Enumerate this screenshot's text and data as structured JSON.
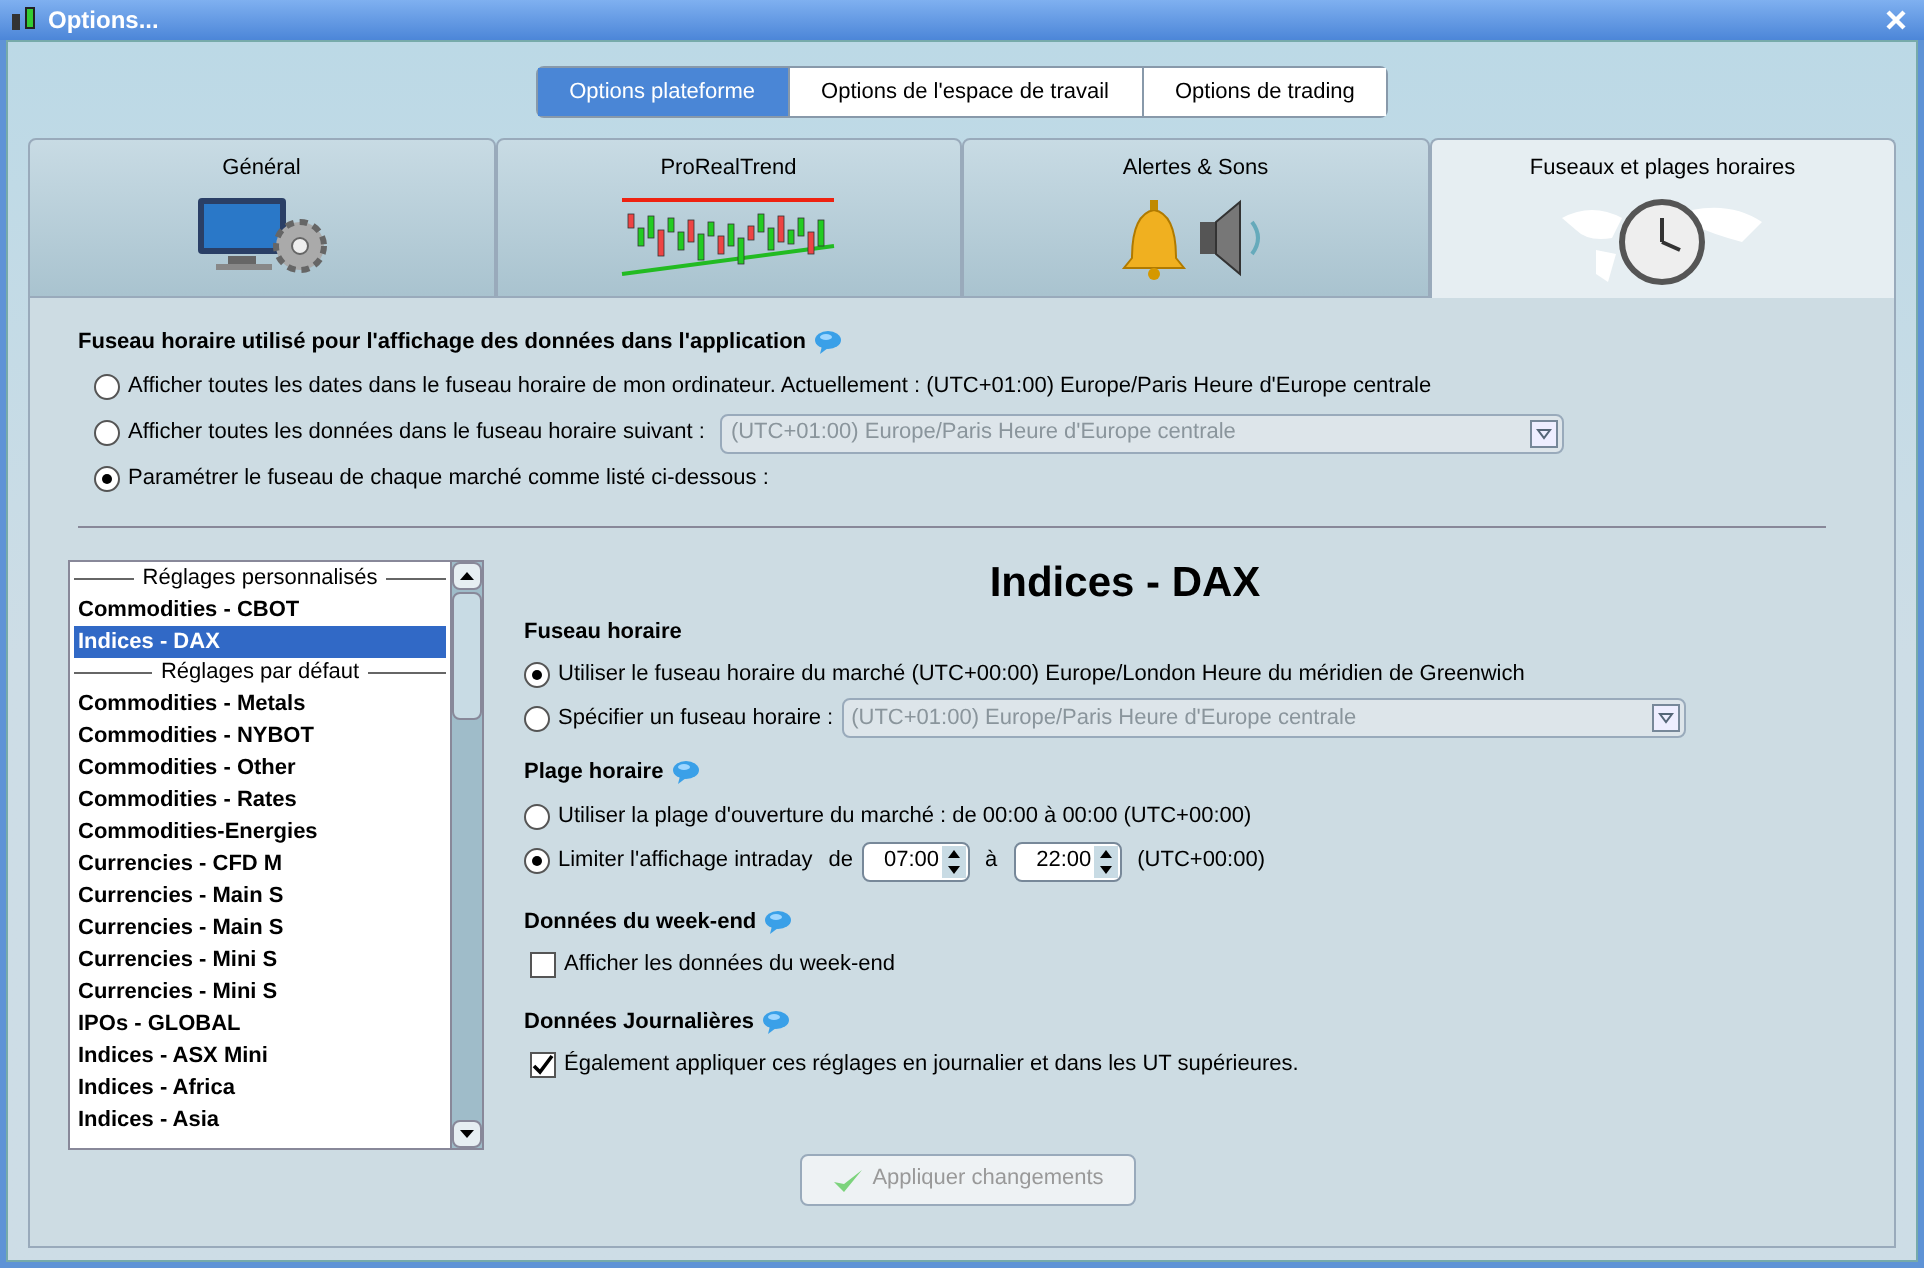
{
  "window": {
    "title": "Options..."
  },
  "top_tabs": [
    {
      "label": "Options plateforme",
      "selected": true
    },
    {
      "label": "Options de l'espace de travail",
      "selected": false
    },
    {
      "label": "Options de trading",
      "selected": false
    }
  ],
  "category_tabs": [
    {
      "label": "Général",
      "kind": "general",
      "selected": false
    },
    {
      "label": "ProRealTrend",
      "kind": "trend",
      "selected": false
    },
    {
      "label": "Alertes & Sons",
      "kind": "alerts",
      "selected": false
    },
    {
      "label": "Fuseaux et plages horaires",
      "kind": "timezones",
      "selected": true
    }
  ],
  "app_timezone": {
    "heading": "Fuseau horaire utilisé pour l'affichage des données dans l'application",
    "options": [
      {
        "label": "Afficher toutes les dates dans le fuseau horaire de mon ordinateur. Actuellement : (UTC+01:00) Europe/Paris Heure d'Europe centrale",
        "selected": false
      },
      {
        "label": "Afficher toutes les données dans le fuseau horaire suivant :",
        "selected": false,
        "dropdown": {
          "value": "(UTC+01:00) Europe/Paris Heure d'Europe centrale",
          "disabled": true
        }
      },
      {
        "label": "Paramétrer le fuseau de chaque marché comme listé ci-dessous :",
        "selected": true
      }
    ]
  },
  "market_list": {
    "items": [
      {
        "kind": "header",
        "label": "Réglages personnalisés"
      },
      {
        "kind": "item",
        "label": "Commodities - CBOT",
        "selected": false
      },
      {
        "kind": "item",
        "label": "Indices - DAX",
        "selected": true
      },
      {
        "kind": "header",
        "label": "Réglages par défaut"
      },
      {
        "kind": "item",
        "label": "Commodities - Metals",
        "selected": false
      },
      {
        "kind": "item",
        "label": "Commodities - NYBOT",
        "selected": false
      },
      {
        "kind": "item",
        "label": "Commodities - Other",
        "selected": false
      },
      {
        "kind": "item",
        "label": "Commodities - Rates",
        "selected": false
      },
      {
        "kind": "item",
        "label": "Commodities-Energies",
        "selected": false
      },
      {
        "kind": "item",
        "label": "Currencies - CFD M",
        "selected": false
      },
      {
        "kind": "item",
        "label": "Currencies - Main S",
        "selected": false
      },
      {
        "kind": "item",
        "label": "Currencies - Main S",
        "selected": false
      },
      {
        "kind": "item",
        "label": "Currencies - Mini S",
        "selected": false
      },
      {
        "kind": "item",
        "label": "Currencies - Mini S",
        "selected": false
      },
      {
        "kind": "item",
        "label": "IPOs - GLOBAL",
        "selected": false
      },
      {
        "kind": "item",
        "label": "Indices - ASX Mini",
        "selected": false
      },
      {
        "kind": "item",
        "label": "Indices - Africa",
        "selected": false
      },
      {
        "kind": "item",
        "label": "Indices - Asia",
        "selected": false
      }
    ]
  },
  "market_settings": {
    "title": "Indices - DAX",
    "timezone": {
      "heading": "Fuseau horaire",
      "options": [
        {
          "label": "Utiliser le fuseau horaire du marché (UTC+00:00) Europe/London Heure du méridien de Greenwich",
          "selected": true
        },
        {
          "label": "Spécifier un fuseau horaire :",
          "selected": false,
          "dropdown": {
            "value": "(UTC+01:00) Europe/Paris Heure d'Europe centrale",
            "disabled": true
          }
        }
      ]
    },
    "hours": {
      "heading": "Plage horaire",
      "options": [
        {
          "kind": "text",
          "label": "Utiliser la plage d'ouverture du marché : de 00:00 à 00:00  (UTC+00:00)",
          "selected": false
        },
        {
          "kind": "range",
          "label": "Limiter l'affichage intraday",
          "from_label": "de",
          "from": "07:00",
          "to_label": "à",
          "to": "22:00",
          "suffix": "(UTC+00:00)",
          "selected": true
        }
      ]
    },
    "weekend": {
      "heading": "Données du week-end",
      "checkbox": {
        "label": "Afficher les données du week-end",
        "checked": false
      }
    },
    "daily": {
      "heading": "Données Journalières",
      "checkbox": {
        "label": "Également appliquer ces réglages en journalier et dans les UT supérieures.",
        "checked": true
      }
    },
    "apply_button": {
      "label": "Appliquer changements",
      "disabled": true
    }
  }
}
